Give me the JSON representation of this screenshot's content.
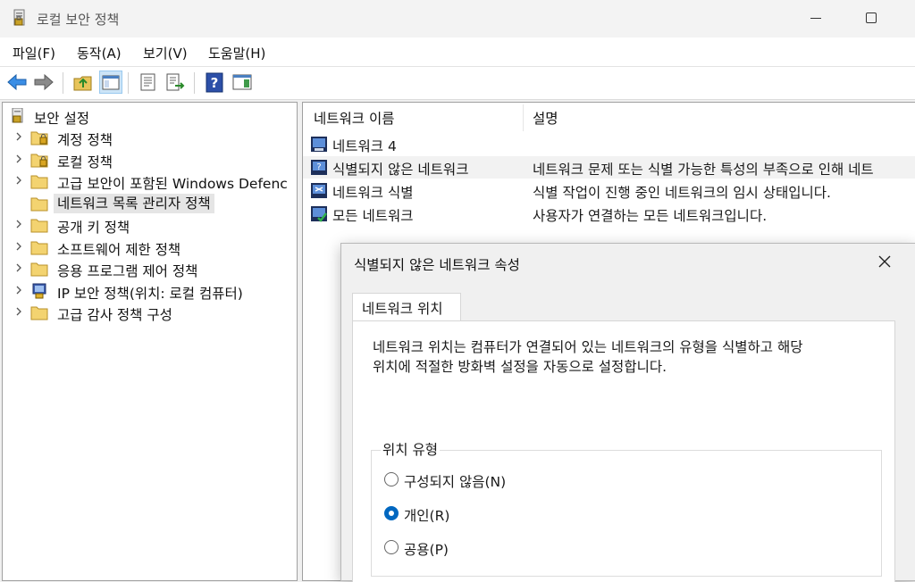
{
  "window": {
    "title": "로컬 보안 정책"
  },
  "menu": [
    "파일(F)",
    "동작(A)",
    "보기(V)",
    "도움말(H)"
  ],
  "toolbar": {
    "buttons": [
      "back-icon",
      "forward-icon",
      "up-folder-icon",
      "show-hide-tree-icon",
      "properties-icon",
      "export-list-icon",
      "help-icon",
      "show-pane-icon"
    ]
  },
  "tree": {
    "root": "보안 설정",
    "items": [
      {
        "label": "계정 정책",
        "icon": "folder-lock-icon"
      },
      {
        "label": "로컬 정책",
        "icon": "folder-lock-icon"
      },
      {
        "label": "고급 보안이 포함된 Windows Defenc",
        "icon": "folder-icon"
      },
      {
        "label": "네트워크 목록 관리자 정책",
        "icon": "folder-icon"
      },
      {
        "label": "공개 키 정책",
        "icon": "folder-icon"
      },
      {
        "label": "소프트웨어 제한 정책",
        "icon": "folder-icon"
      },
      {
        "label": "응용 프로그램 제어 정책",
        "icon": "folder-icon"
      },
      {
        "label": "IP 보안 정책(위치: 로컬 컴퓨터)",
        "icon": "ip-security-icon"
      },
      {
        "label": "고급 감사 정책 구성",
        "icon": "folder-icon"
      }
    ],
    "selected_index": 3
  },
  "list": {
    "columns": [
      "네트워크 이름",
      "설명"
    ],
    "rows": [
      {
        "name": "네트워크 4",
        "desc": ""
      },
      {
        "name": "식별되지 않은 네트워크",
        "desc": "네트워크 문제 또는 식별 가능한 특성의 부족으로 인해 네트"
      },
      {
        "name": "네트워크 식별",
        "desc": "식별 작업이 진행 중인 네트워크의 임시 상태입니다."
      },
      {
        "name": "모든 네트워크",
        "desc": "사용자가 연결하는 모든 네트워크입니다."
      }
    ]
  },
  "dialog": {
    "title": "식별되지 않은 네트워크 속성",
    "tab": "네트워크 위치",
    "desc_line1": "네트워크 위치는 컴퓨터가 연결되어 있는 네트워크의 유형을 식별하고 해당",
    "desc_line2": "위치에 적절한 방화벽 설정을 자동으로 설정합니다.",
    "group_title": "위치 유형",
    "options": [
      "구성되지 않음(N)",
      "개인(R)",
      "공용(P)"
    ],
    "selected_option": 1
  },
  "colors": {
    "accent": "#0067c0",
    "selection": "#e5e5e5"
  }
}
